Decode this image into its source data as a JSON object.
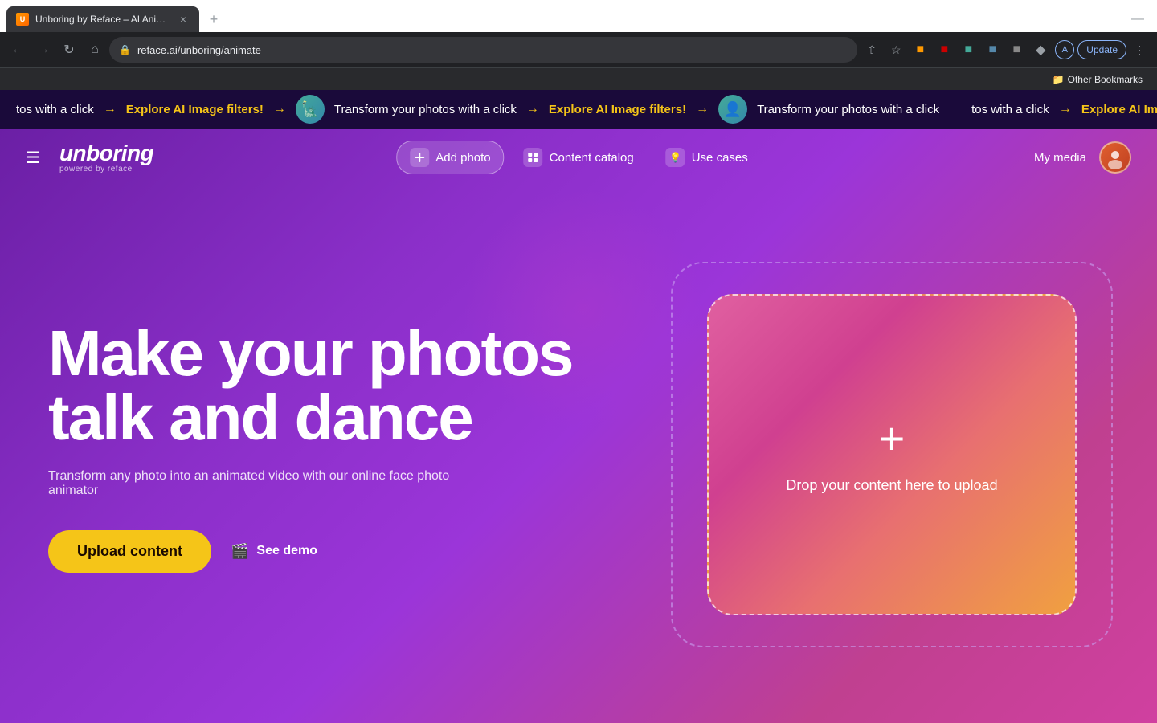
{
  "browser": {
    "tab": {
      "favicon": "U",
      "title": "Unboring by Reface – AI Anim...",
      "close_label": "×"
    },
    "new_tab_label": "+",
    "window_minimize": "—",
    "address": {
      "lock_icon": "🔒",
      "url": "reface.ai/unboring/animate"
    },
    "toolbar": {
      "share_icon": "↑",
      "bookmark_icon": "☆",
      "extensions_icon": "⊞",
      "profile": "A",
      "update_label": "Update",
      "more_icon": "⋮"
    },
    "bookmarks": {
      "folder_icon": "📁",
      "label": "Other Bookmarks"
    }
  },
  "marquee": {
    "items": [
      {
        "white_text": "tos with a click",
        "arrow": "→",
        "yellow_text": "Explore AI Image filters!",
        "arrow2": "→",
        "has_avatar": true,
        "white_text2": "Transform your photos with a click",
        "arrow3": "→",
        "yellow_text2": "Explore AI Image filters!",
        "arrow4": "→",
        "has_avatar2": true,
        "white_text3": "Transform your photos wi"
      }
    ]
  },
  "nav": {
    "hamburger": "☰",
    "logo_main": "unboring",
    "logo_sub": "powered by reface",
    "links": [
      {
        "id": "add-photo",
        "icon": "+",
        "label": "Add photo"
      },
      {
        "id": "content-catalog",
        "icon": "⊞",
        "label": "Content catalog"
      },
      {
        "id": "use-cases",
        "icon": "💡",
        "label": "Use cases"
      }
    ],
    "my_media": "My media",
    "user_avatar": "👤"
  },
  "hero": {
    "title_line1": "Make your photos",
    "title_line2": "talk and dance",
    "subtitle": "Transform any photo into an animated video with our online face photo animator",
    "upload_btn": "Upload content",
    "demo_icon": "🎬",
    "demo_label": "See demo",
    "upload_zone": {
      "plus": "+",
      "label": "Drop your content here to upload"
    }
  }
}
